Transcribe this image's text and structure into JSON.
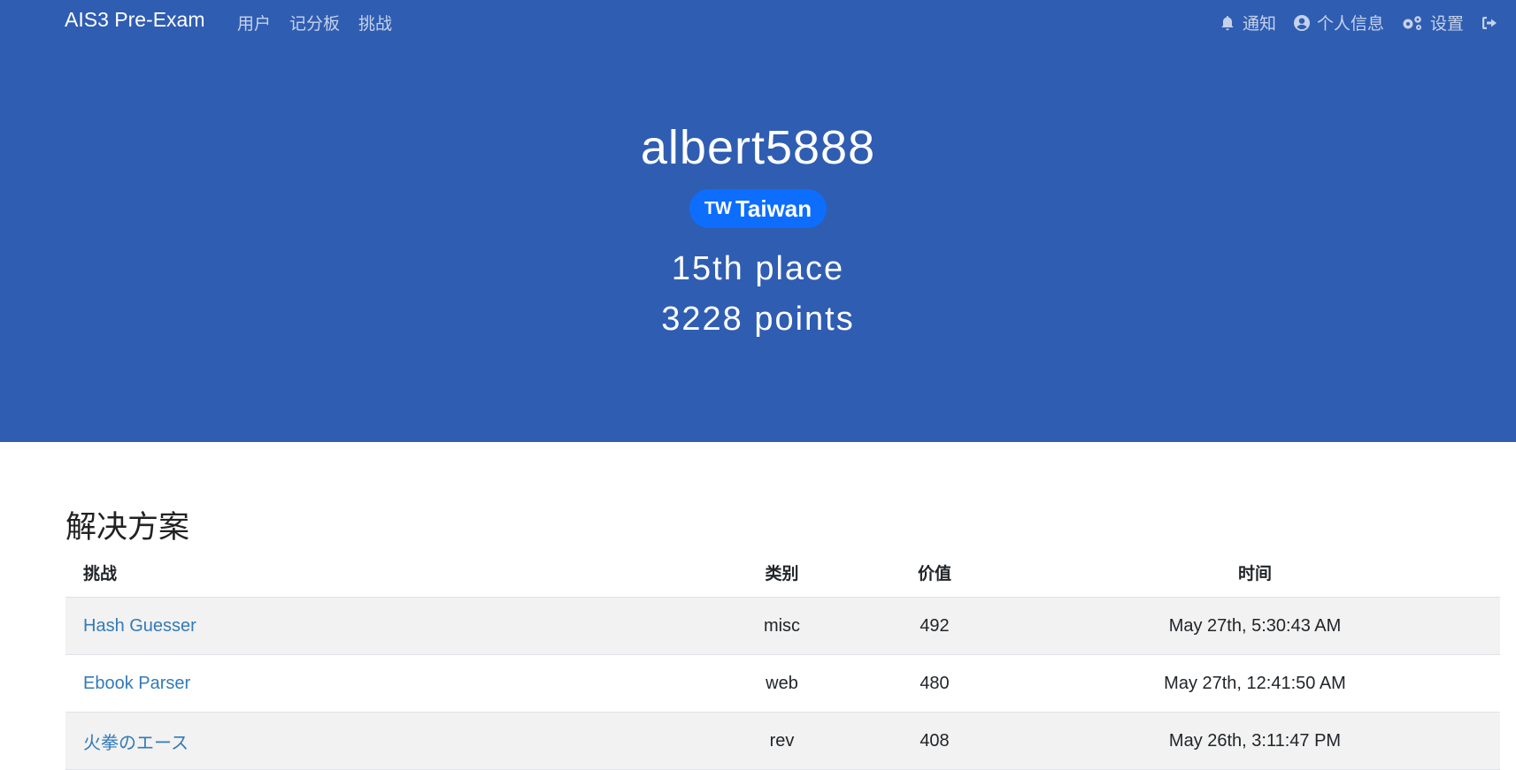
{
  "nav": {
    "brand": "AIS3 Pre-Exam",
    "links": [
      "用户",
      "记分板",
      "挑战"
    ],
    "right": [
      {
        "label": "通知",
        "icon": "bell-icon"
      },
      {
        "label": "个人信息",
        "icon": "user-circle-icon"
      },
      {
        "label": "设置",
        "icon": "gears-icon"
      },
      {
        "label": "",
        "icon": "sign-out-icon"
      }
    ]
  },
  "profile": {
    "username": "albert5888",
    "country_code": "TW",
    "country": "Taiwan",
    "place": "15th place",
    "points": "3228 points"
  },
  "solves": {
    "title": "解决方案",
    "headers": [
      "挑战",
      "类别",
      "价值",
      "时间"
    ],
    "rows": [
      {
        "challenge": "Hash Guesser",
        "category": "misc",
        "value": "492",
        "time": "May 27th, 5:30:43 AM"
      },
      {
        "challenge": "Ebook Parser",
        "category": "web",
        "value": "480",
        "time": "May 27th, 12:41:50 AM"
      },
      {
        "challenge": "火拳のエース",
        "category": "rev",
        "value": "408",
        "time": "May 26th, 3:11:47 PM"
      }
    ]
  },
  "colors": {
    "hero": "#2f5db2",
    "badge": "#0d6efd",
    "link": "#337ab7"
  }
}
